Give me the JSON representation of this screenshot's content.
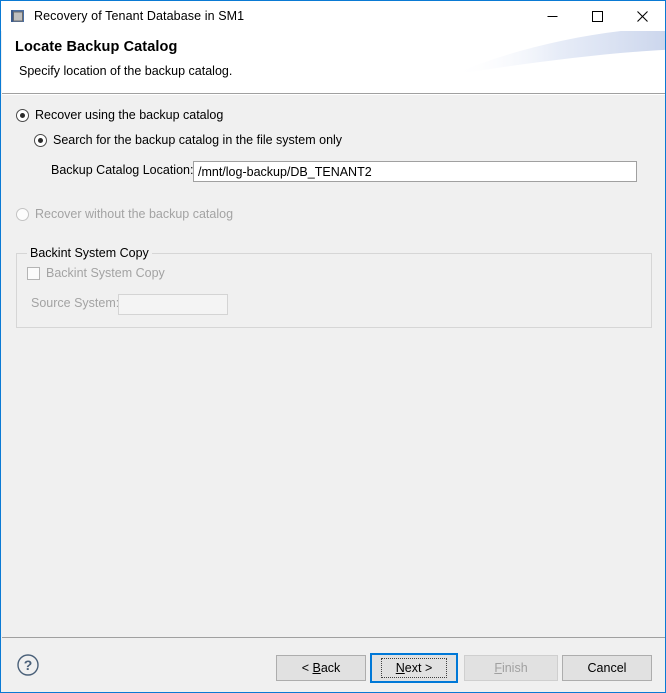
{
  "window": {
    "title": "Recovery of Tenant Database in SM1",
    "icon": "database-window-icon",
    "controls": {
      "minimize": "minimize-icon",
      "maximize": "maximize-icon",
      "close": "close-icon"
    }
  },
  "header": {
    "title": "Locate Backup Catalog",
    "subtitle": "Specify location of the backup catalog."
  },
  "content": {
    "recover_with_catalog": {
      "label": "Recover using the backup catalog",
      "checked": true
    },
    "search_file_system": {
      "label": "Search for the backup catalog in the file system only",
      "checked": true
    },
    "catalog_location": {
      "label": "Backup Catalog Location:",
      "value": "/mnt/log-backup/DB_TENANT2",
      "placeholder": ""
    },
    "recover_without_catalog": {
      "label": "Recover without the backup catalog",
      "checked": false,
      "disabled": true
    },
    "backint_group": {
      "title": "Backint System Copy",
      "checkbox_label": "Backint System Copy",
      "checkbox_checked": false,
      "source_system_label": "Source System:",
      "source_system_value": "",
      "disabled": true
    }
  },
  "footer": {
    "help_icon": "help-question-icon",
    "buttons": {
      "back": {
        "prefix": "< ",
        "accel": "B",
        "rest": "ack"
      },
      "next": {
        "accel": "N",
        "rest": "ext",
        "suffix": " >"
      },
      "finish": {
        "accel": "F",
        "rest": "inish",
        "disabled": true
      },
      "cancel": {
        "label": "Cancel"
      }
    }
  },
  "colors": {
    "window_border": "#0a7ad4",
    "content_bg": "#f0f0f0",
    "header_bg": "#ffffff",
    "accent": "#0078d7",
    "disabled_text": "#a3a3a3"
  }
}
